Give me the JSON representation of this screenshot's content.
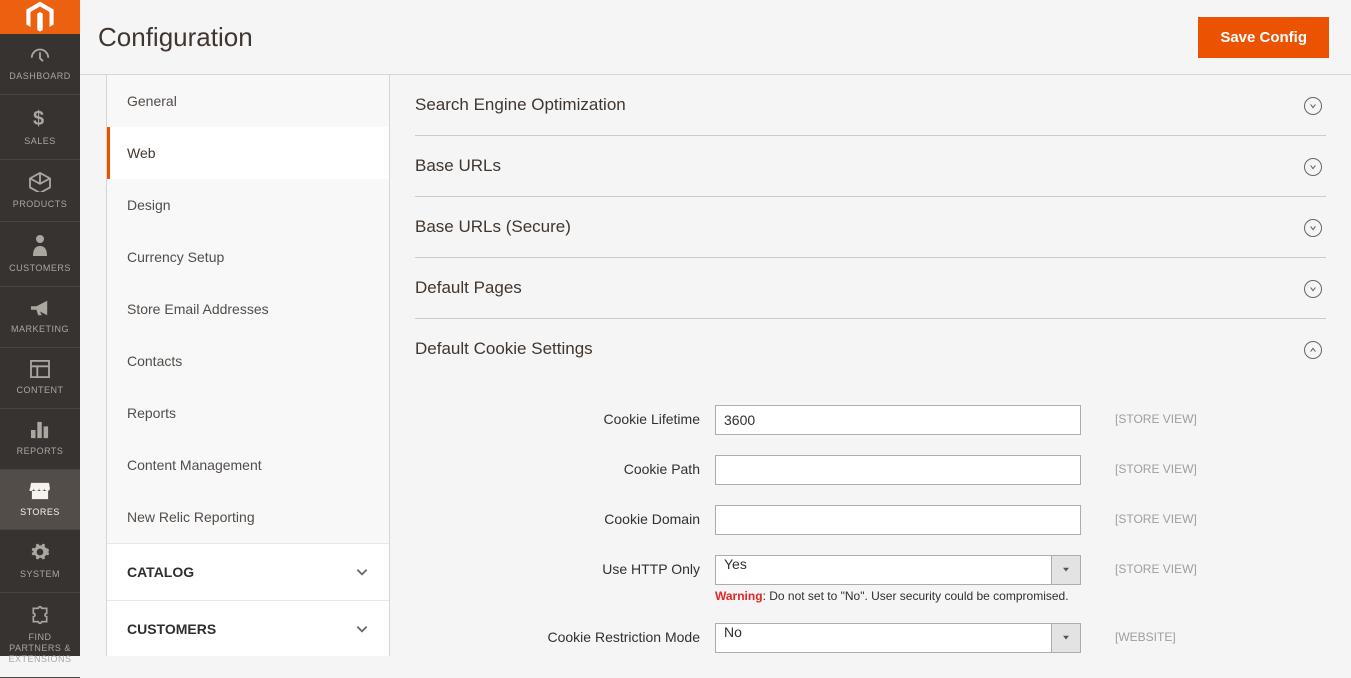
{
  "header": {
    "title": "Configuration",
    "save_label": "Save Config"
  },
  "nav": [
    {
      "label": "DASHBOARD"
    },
    {
      "label": "SALES"
    },
    {
      "label": "PRODUCTS"
    },
    {
      "label": "CUSTOMERS"
    },
    {
      "label": "MARKETING"
    },
    {
      "label": "CONTENT"
    },
    {
      "label": "REPORTS"
    },
    {
      "label": "STORES"
    },
    {
      "label": "SYSTEM"
    },
    {
      "label": "FIND PARTNERS & EXTENSIONS"
    }
  ],
  "sidebar": {
    "general_items": [
      "General",
      "Web",
      "Design",
      "Currency Setup",
      "Store Email Addresses",
      "Contacts",
      "Reports",
      "Content Management",
      "New Relic Reporting"
    ],
    "groups": [
      "CATALOG",
      "CUSTOMERS"
    ]
  },
  "sections": {
    "seo": "Search Engine Optimization",
    "base": "Base URLs",
    "secure": "Base URLs (Secure)",
    "pages": "Default Pages",
    "cookie": "Default Cookie Settings"
  },
  "cookie": {
    "lifetime_label": "Cookie Lifetime",
    "lifetime_value": "3600",
    "lifetime_scope": "[STORE VIEW]",
    "path_label": "Cookie Path",
    "path_value": "",
    "path_scope": "[STORE VIEW]",
    "domain_label": "Cookie Domain",
    "domain_value": "",
    "domain_scope": "[STORE VIEW]",
    "http_label": "Use HTTP Only",
    "http_value": "Yes",
    "http_scope": "[STORE VIEW]",
    "http_warn_prefix": "Warning",
    "http_warn_text": ": Do not set to \"No\". User security could be compromised.",
    "restrict_label": "Cookie Restriction Mode",
    "restrict_value": "No",
    "restrict_scope": "[WEBSITE]"
  }
}
